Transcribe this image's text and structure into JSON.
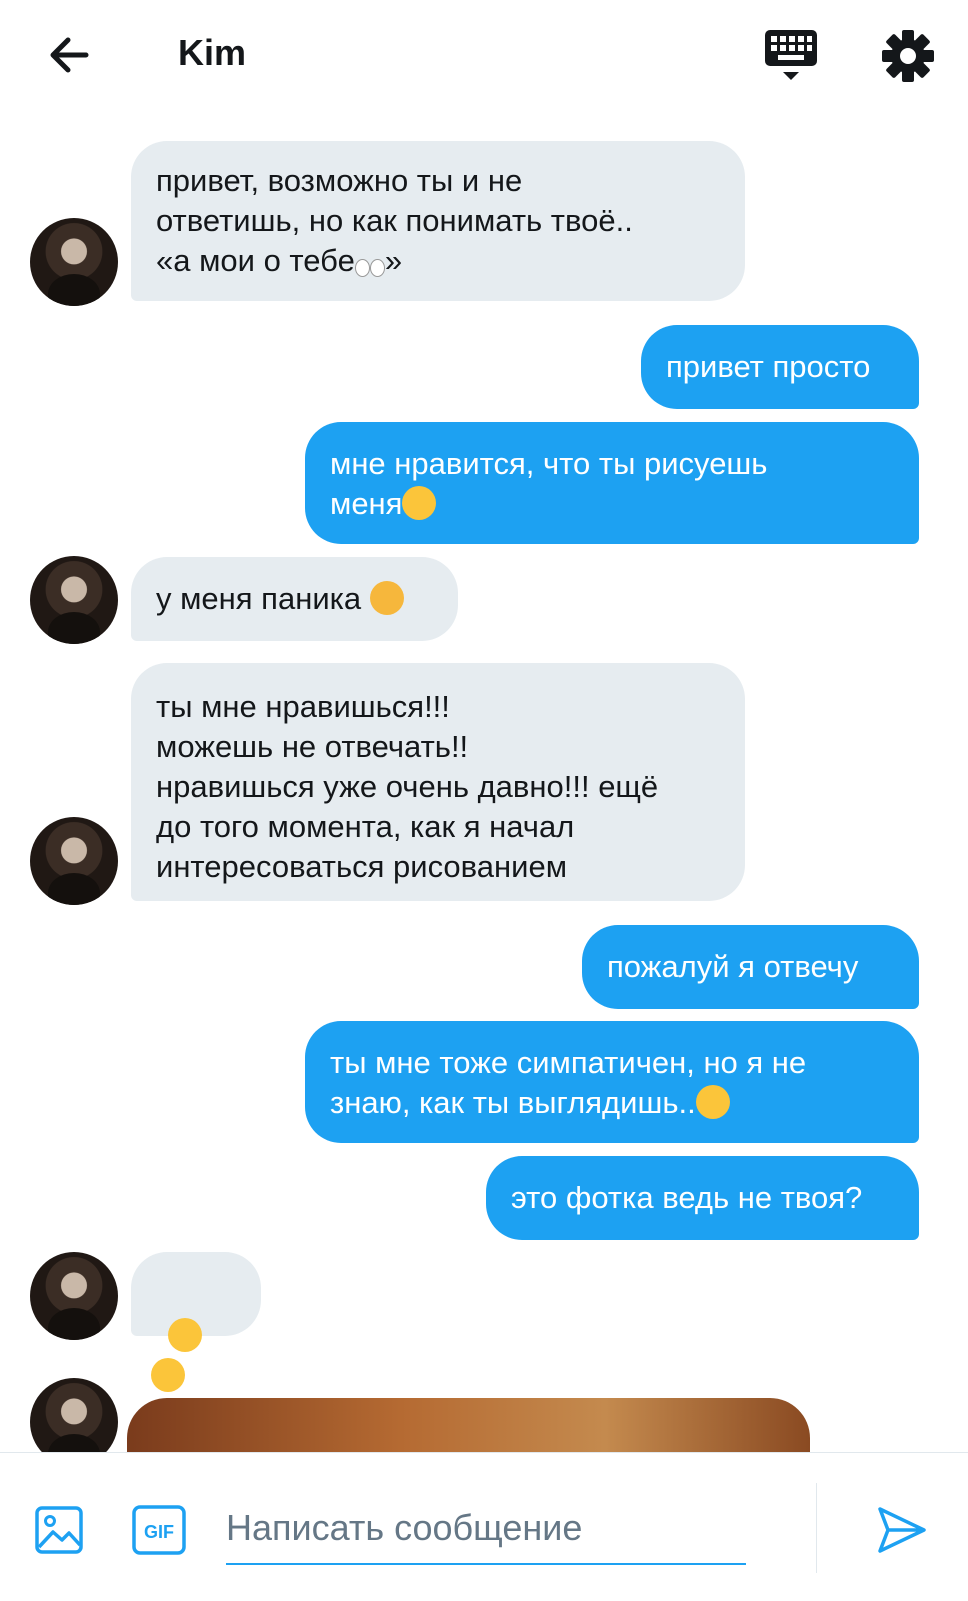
{
  "header": {
    "title": "Kim",
    "back_icon": "arrow-left-icon",
    "keyboard_icon": "keyboard-icon",
    "settings_icon": "gear-icon"
  },
  "messages": [
    {
      "side": "in",
      "text": "привет, возможно ты и не\nответишь, но как понимать твоё..\n«а мои о тебе",
      "text_after": "»",
      "emoji": "eyes"
    },
    {
      "side": "out",
      "text": "привет просто"
    },
    {
      "side": "out",
      "text": "мне нравится, что ты рисуешь\nменя",
      "emoji": "grinning-face"
    },
    {
      "side": "in",
      "text": "у меня паника ",
      "emoji": "exploding-head"
    },
    {
      "side": "in",
      "text": "ты мне нравишься!!!\nможешь не отвечать!!\nнравишься уже очень давно!!! ещё\nдо того момента, как я начал\nинтересоваться рисованием"
    },
    {
      "side": "out",
      "text": "пожалуй я отвечу"
    },
    {
      "side": "out",
      "text": "ты мне тоже симпатичен, но я не\nзнаю, как ты выглядишь..",
      "emoji": "expressionless-face"
    },
    {
      "side": "out",
      "text": "это фотка ведь не твоя?"
    },
    {
      "side": "in",
      "text": "",
      "emoji": "flushed-faces"
    }
  ],
  "composer": {
    "placeholder": "Написать сообщение",
    "image_icon": "image-icon",
    "gif_label": "GIF",
    "send_icon": "send-icon"
  },
  "colors": {
    "accent": "#1da1f2",
    "incoming_bubble": "#e6ecf0",
    "text": "#14171a"
  }
}
